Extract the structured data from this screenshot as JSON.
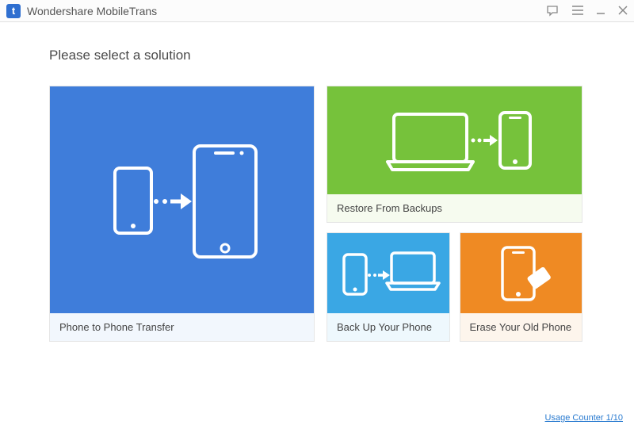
{
  "app": {
    "title": "Wondershare MobileTrans"
  },
  "heading": "Please select a solution",
  "cards": {
    "transfer": {
      "label": "Phone to Phone Transfer"
    },
    "restore": {
      "label": "Restore From Backups"
    },
    "backup": {
      "label": "Back Up Your Phone"
    },
    "erase": {
      "label": "Erase Your Old Phone"
    }
  },
  "footer": {
    "usage_counter": "Usage Counter 1/10"
  },
  "colors": {
    "blue": "#3f7dda",
    "green": "#76c23b",
    "lightblue": "#3aa7e4",
    "orange": "#ef8a23"
  }
}
